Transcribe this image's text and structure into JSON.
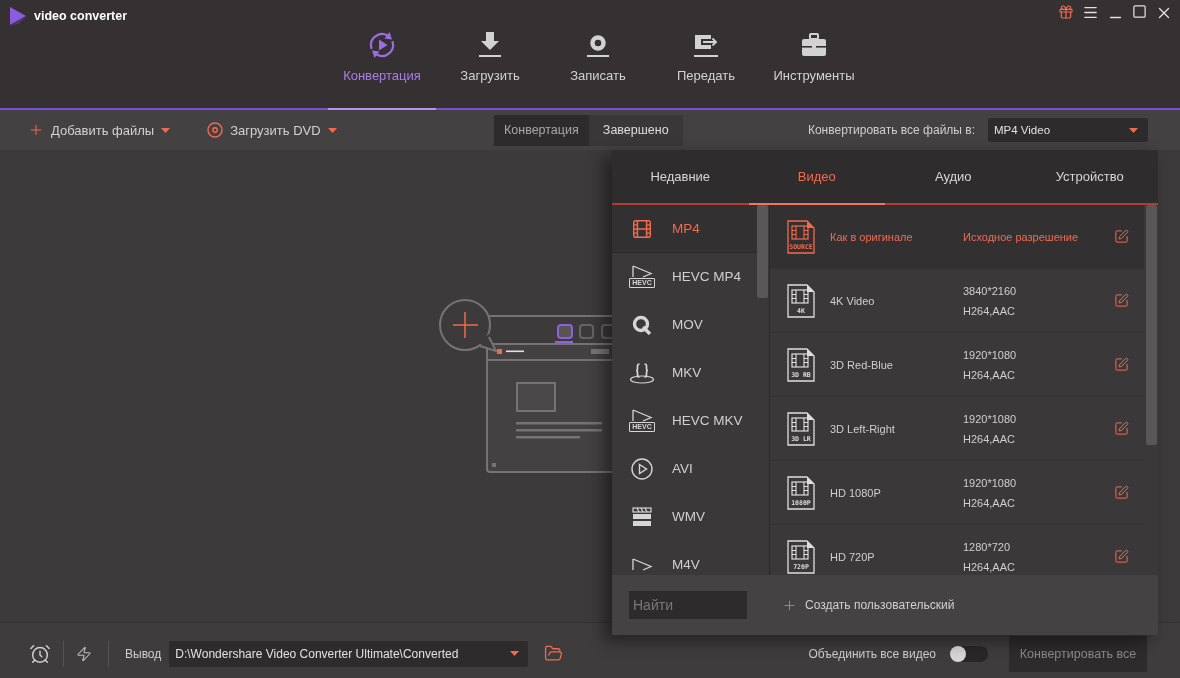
{
  "window": {
    "title": "video converter"
  },
  "nav_tabs": [
    {
      "label": "Конвертация",
      "selected": true
    },
    {
      "label": "Загрузить",
      "selected": false
    },
    {
      "label": "Записать",
      "selected": false
    },
    {
      "label": "Передать",
      "selected": false
    },
    {
      "label": "Инструменты",
      "selected": false
    }
  ],
  "toolbar": {
    "add_files": "Добавить файлы",
    "load_dvd": "Загрузить DVD",
    "view_tabs": [
      {
        "label": "Конвертация",
        "selected": true
      },
      {
        "label": "Завершено",
        "selected": false
      }
    ],
    "output_format_label": "Конвертировать все файлы в:",
    "output_format": {
      "value": "MP4 Video"
    }
  },
  "format_panel": {
    "tabs": [
      {
        "label": "Недавние",
        "selected": false
      },
      {
        "label": "Видео",
        "selected": true
      },
      {
        "label": "Аудио",
        "selected": false
      },
      {
        "label": "Устройство",
        "selected": false
      }
    ],
    "formats": [
      {
        "label": "MP4",
        "selected": true
      },
      {
        "label": "HEVC MP4",
        "badge": "HEVC",
        "selected": false
      },
      {
        "label": "MOV",
        "selected": false
      },
      {
        "label": "MKV",
        "selected": false
      },
      {
        "label": "HEVC MKV",
        "badge": "HEVC",
        "selected": false
      },
      {
        "label": "AVI",
        "selected": false
      },
      {
        "label": "WMV",
        "selected": false
      },
      {
        "label": "M4V",
        "selected": false
      }
    ],
    "presets": [
      {
        "name": "Как в оригинале",
        "badge": "SOURCE",
        "resolution": "Исходное разрешение",
        "selected": true
      },
      {
        "name": "4K Video",
        "badge": "4K",
        "resolution": "3840*2160",
        "codecs": "H264,AAC",
        "selected": false
      },
      {
        "name": "3D Red-Blue",
        "badge": "3D RB",
        "resolution": "1920*1080",
        "codecs": "H264,AAC",
        "selected": false
      },
      {
        "name": "3D Left-Right",
        "badge": "3D LR",
        "resolution": "1920*1080",
        "codecs": "H264,AAC",
        "selected": false
      },
      {
        "name": "HD 1080P",
        "badge": "1080P",
        "resolution": "1920*1080",
        "codecs": "H264,AAC",
        "selected": false
      },
      {
        "name": "HD 720P",
        "badge": "720P",
        "resolution": "1280*720",
        "codecs": "H264,AAC",
        "selected": false
      }
    ],
    "search": {
      "placeholder": "Найти"
    },
    "create_custom": "Создать пользовательский"
  },
  "bottom_bar": {
    "output_label": "Вывод",
    "output_path": {
      "value": "D:\\Wondershare Video Converter Ultimate\\Converted"
    },
    "merge_label": "Объединить все видео",
    "merge_toggle": {
      "on": false
    },
    "convert_all": {
      "label": "Конвертировать все",
      "disabled": true
    }
  }
}
